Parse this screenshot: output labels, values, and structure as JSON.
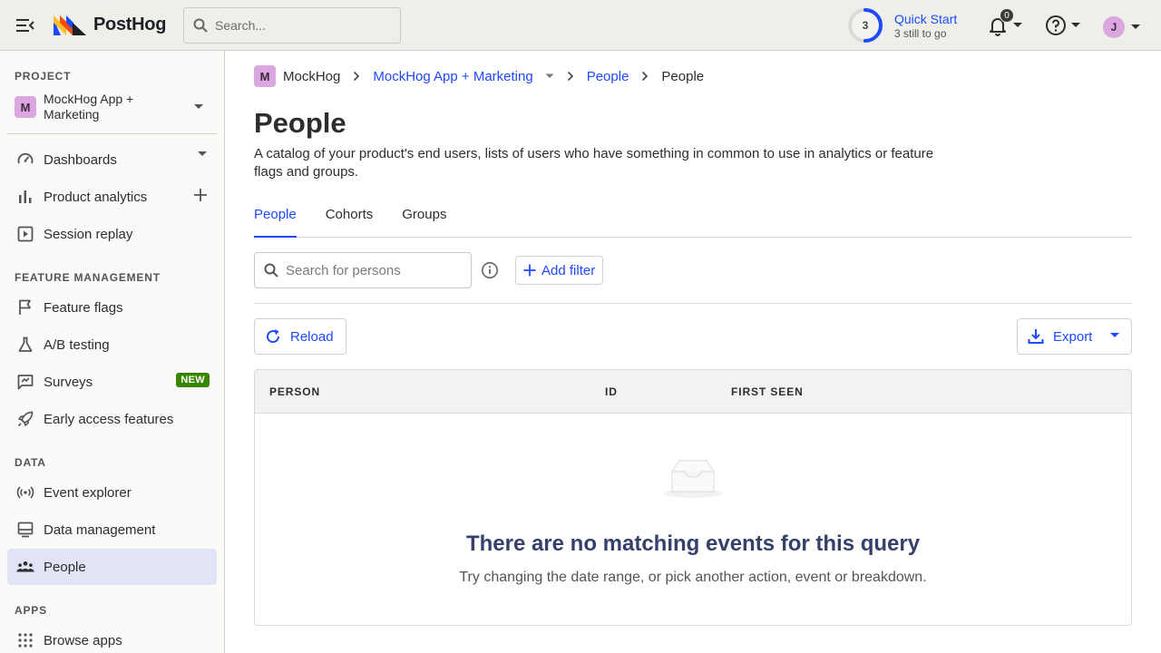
{
  "app": {
    "brand": "PostHog",
    "search": {
      "placeholder": "Search..."
    },
    "quick_start": {
      "count": "3",
      "title": "Quick Start",
      "subtitle": "3 still to go",
      "progress": 0.5
    },
    "notifications": {
      "count": "0"
    },
    "user": {
      "initial": "J"
    }
  },
  "sidebar": {
    "project_section": "PROJECT",
    "project": {
      "badge": "M",
      "name": "MockHog App + Marketing"
    },
    "items_top": [
      {
        "label": "Dashboards",
        "icon": "gauge-icon"
      },
      {
        "label": "Product analytics",
        "icon": "bar-chart-icon"
      },
      {
        "label": "Session replay",
        "icon": "play-square-icon"
      }
    ],
    "feature_section": "FEATURE MANAGEMENT",
    "items_feature": [
      {
        "label": "Feature flags",
        "icon": "flag-icon"
      },
      {
        "label": "A/B testing",
        "icon": "flask-icon"
      },
      {
        "label": "Surveys",
        "icon": "survey-icon",
        "badge": "NEW"
      },
      {
        "label": "Early access features",
        "icon": "rocket-icon"
      }
    ],
    "data_section": "DATA",
    "items_data": [
      {
        "label": "Event explorer",
        "icon": "broadcast-icon"
      },
      {
        "label": "Data management",
        "icon": "database-icon"
      },
      {
        "label": "People",
        "icon": "people-icon"
      }
    ],
    "apps_section": "APPS",
    "items_apps": [
      {
        "label": "Browse apps",
        "icon": "grid-icon"
      }
    ]
  },
  "breadcrumb": {
    "org_badge": "M",
    "org": "MockHog",
    "project": "MockHog App + Marketing",
    "section": "People",
    "current": "People"
  },
  "page": {
    "title": "People",
    "description": "A catalog of your product's end users, lists of users who have something in common to use in analytics or feature flags and groups."
  },
  "tabs": [
    "People",
    "Cohorts",
    "Groups"
  ],
  "filters": {
    "search_placeholder": "Search for persons",
    "add_filter": "Add filter"
  },
  "actions": {
    "reload": "Reload",
    "export": "Export"
  },
  "table": {
    "columns": [
      "PERSON",
      "ID",
      "FIRST SEEN"
    ],
    "empty_title": "There are no matching events for this query",
    "empty_subtitle": "Try changing the date range, or pick another action, event or breakdown."
  },
  "colors": {
    "accent": "#1d4aff",
    "active_bg": "#e1e4f6",
    "new_badge": "#388600",
    "avatar": "#dca6e0"
  }
}
